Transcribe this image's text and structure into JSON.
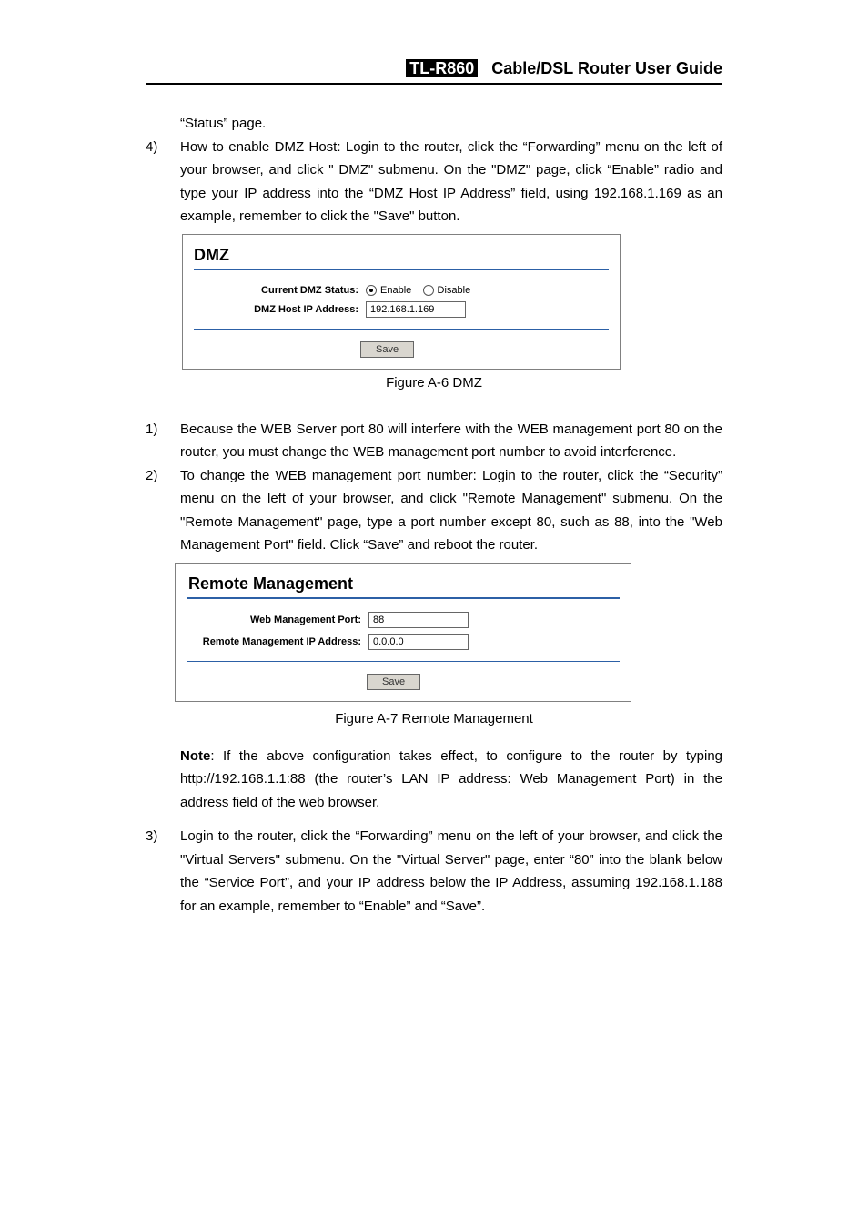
{
  "header": {
    "model": "TL-R860",
    "title": "Cable/DSL  Router  User  Guide"
  },
  "para1_cont": "“Status” page.",
  "step4_num": "4)",
  "step4": "How to enable DMZ Host: Login to the router, click the “Forwarding” menu on the left of your browser, and click \" DMZ\" submenu. On the \"DMZ\" page, click “Enable” radio and type your IP address into the “DMZ Host IP Address” field, using 192.168.1.169 as an example, remember to click the \"Save\" button.",
  "panelA": {
    "title": "DMZ",
    "statusLabel": "Current DMZ Status:",
    "enable": "Enable",
    "disable": "Disable",
    "ipLabel": "DMZ Host IP Address:",
    "ipValue": "192.168.1.169",
    "save": "Save"
  },
  "figA6": "Figure A-6    DMZ",
  "step1_num": "1)",
  "step1": "Because the WEB Server port 80 will interfere with the WEB management port 80 on the router, you must change the WEB management port number to avoid interference.",
  "step2_num": "2)",
  "step2": "To change the WEB management port number: Login to the router, click the “Security” menu on the left of your browser, and click \"Remote Management\" submenu. On the \"Remote Management\" page, type a port number except 80, such as 88, into the \"Web Management Port\" field. Click “Save” and reboot the router.",
  "panelB": {
    "title": "Remote Management",
    "portLabel": "Web Management Port:",
    "portValue": "88",
    "ipLabel": "Remote Management IP Address:",
    "ipValue": "0.0.0.0",
    "save": "Save"
  },
  "figA7": "Figure A-7    Remote Management",
  "noteLabel": "Note",
  "noteText": ": If the above configuration takes effect, to configure to the router by typing http://192.168.1.1:88 (the router’s LAN IP address: Web Management Port) in the address field of the web browser.",
  "step3_num": "3)",
  "step3": "Login to the router, click the “Forwarding” menu on the left of your browser, and click the \"Virtual Servers\" submenu. On the \"Virtual Server\" page, enter “80” into the blank below the “Service Port”, and your IP address below the IP Address, assuming 192.168.1.188 for an example, remember to “Enable” and “Save”."
}
